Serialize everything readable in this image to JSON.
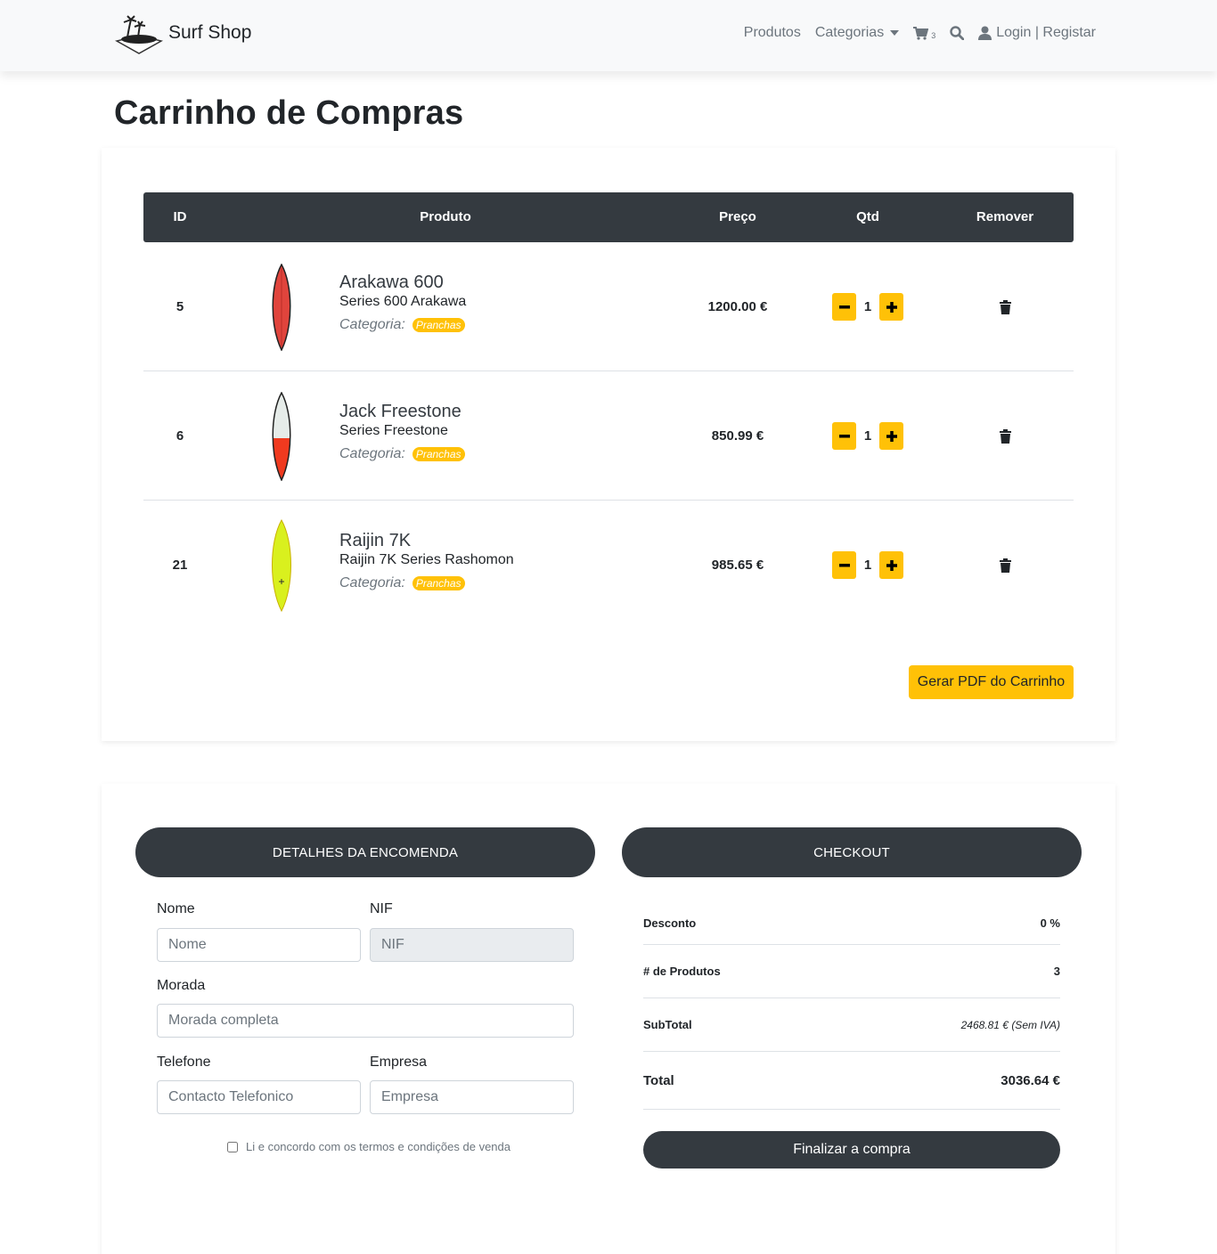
{
  "navbar": {
    "brand": "Surf Shop",
    "products": "Produtos",
    "categories": "Categorias",
    "cart_count": "3",
    "login": "Login | Registar"
  },
  "page": {
    "title": "Carrinho de Compras"
  },
  "cart": {
    "headers": {
      "id": "ID",
      "product": "Produto",
      "price": "Preço",
      "qty": "Qtd",
      "remove": "Remover"
    },
    "category_label": "Categoria:",
    "items": [
      {
        "id": "5",
        "name": "Arakawa 600",
        "series": "Series 600 Arakawa",
        "category": "Pranchas",
        "price": "1200.00 €",
        "qty": "1",
        "board_color": "#e0443c"
      },
      {
        "id": "6",
        "name": "Jack Freestone",
        "series": "Series Freestone",
        "category": "Pranchas",
        "price": "850.99 €",
        "qty": "1",
        "board_color": "#f03a1f"
      },
      {
        "id": "21",
        "name": "Raijin 7K",
        "series": "Raijin 7K Series Rashomon",
        "category": "Pranchas",
        "price": "985.65 €",
        "qty": "1",
        "board_color": "#d9f01e"
      }
    ],
    "pdf_button": "Gerar PDF do Carrinho"
  },
  "order": {
    "details_title": "DETALHES DA ENCOMENDA",
    "name_label": "Nome",
    "name_placeholder": "Nome",
    "nif_label": "NIF",
    "nif_placeholder": "NIF",
    "address_label": "Morada",
    "address_placeholder": "Morada completa",
    "phone_label": "Telefone",
    "phone_placeholder": "Contacto Telefonico",
    "company_label": "Empresa",
    "company_placeholder": "Empresa",
    "terms": "Li e concordo com os termos e condições de venda"
  },
  "checkout": {
    "title": "CHECKOUT",
    "discount_label": "Desconto",
    "discount_value": "0 %",
    "count_label": "# de Produtos",
    "count_value": "3",
    "subtotal_label": "SubTotal",
    "subtotal_value": "2468.81 € (Sem IVA)",
    "total_label": "Total",
    "total_value": "3036.64 €",
    "finish_button": "Finalizar a compra"
  },
  "colors": {
    "accent": "#ffc107",
    "dark": "#343a40"
  }
}
